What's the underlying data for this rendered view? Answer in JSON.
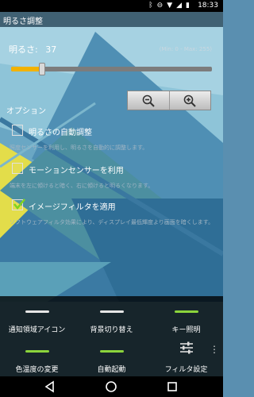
{
  "status_bar": {
    "time": "18:33"
  },
  "title_bar": {
    "title": "明るさ調整"
  },
  "brightness": {
    "label": "明るさ:",
    "value": "37",
    "range_hint": "(Min: 0 - Max: 255)",
    "slider_level_fraction": 0.145
  },
  "zoom": {
    "out_icon": "zoom-out-icon",
    "in_icon": "zoom-in-icon"
  },
  "options": {
    "heading": "オプション",
    "items": [
      {
        "label": "明るさの自動調整",
        "description": "照度センサーを利用し、明るさを自動的に調整します。",
        "checked": false
      },
      {
        "label": "モーションセンサーを利用",
        "description": "端末を左に傾けると暗く、右に傾けると明るくなります。",
        "checked": false
      },
      {
        "label": "イメージフィルタを適用",
        "description": "ソフトウェアフィルタ効果により、ディスプレイ最低輝度より画面を暗くします。",
        "checked": true
      }
    ]
  },
  "menu": {
    "items": [
      {
        "label": "通知領域アイコン",
        "indicator": "#e6e6e6"
      },
      {
        "label": "背景切り替え",
        "indicator": "#e6e6e6"
      },
      {
        "label": "キー照明",
        "indicator": "#8bd43c"
      },
      {
        "label": "色温度の変更",
        "indicator": "#8bd43c"
      },
      {
        "label": "自動起動",
        "indicator": "#8bd43c"
      },
      {
        "label": "フィルタ設定",
        "icon": "sliders-icon"
      }
    ]
  },
  "colors": {
    "accent": "#f2b200",
    "checkmark": "#7ed321",
    "indicator_on": "#8bd43c"
  }
}
